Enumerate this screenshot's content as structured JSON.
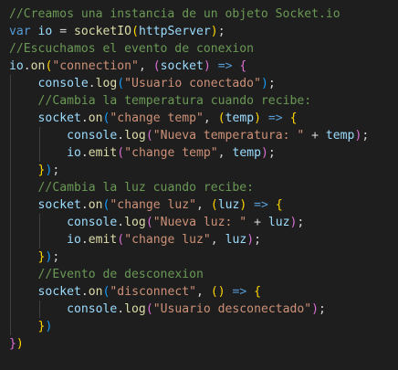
{
  "code_lines": [
    {
      "indent": 0,
      "tokens": [
        {
          "c": "cm",
          "t": "//Creamos una instancia de un objeto Socket.io"
        }
      ]
    },
    {
      "indent": 0,
      "tokens": [
        {
          "c": "kw",
          "t": "var"
        },
        {
          "c": "pn",
          "t": " "
        },
        {
          "c": "vr",
          "t": "io"
        },
        {
          "c": "pn",
          "t": " = "
        },
        {
          "c": "fn",
          "t": "socketIO"
        },
        {
          "c": "b1",
          "t": "("
        },
        {
          "c": "vr",
          "t": "httpServer"
        },
        {
          "c": "b1",
          "t": ")"
        },
        {
          "c": "pn",
          "t": ";"
        }
      ]
    },
    {
      "indent": 0,
      "tokens": [
        {
          "c": "cm",
          "t": "//Escuchamos el evento de conexion"
        }
      ]
    },
    {
      "indent": 0,
      "tokens": [
        {
          "c": "vr",
          "t": "io"
        },
        {
          "c": "pn",
          "t": "."
        },
        {
          "c": "fn",
          "t": "on"
        },
        {
          "c": "b1",
          "t": "("
        },
        {
          "c": "st",
          "t": "\"connection\""
        },
        {
          "c": "pn",
          "t": ", "
        },
        {
          "c": "b2",
          "t": "("
        },
        {
          "c": "vr",
          "t": "socket"
        },
        {
          "c": "b2",
          "t": ")"
        },
        {
          "c": "pn",
          "t": " "
        },
        {
          "c": "kw",
          "t": "=>"
        },
        {
          "c": "pn",
          "t": " "
        },
        {
          "c": "b2",
          "t": "{"
        }
      ]
    },
    {
      "indent": 1,
      "tokens": [
        {
          "c": "vr",
          "t": "console"
        },
        {
          "c": "pn",
          "t": "."
        },
        {
          "c": "fn",
          "t": "log"
        },
        {
          "c": "b3",
          "t": "("
        },
        {
          "c": "st",
          "t": "\"Usuario conectado\""
        },
        {
          "c": "b3",
          "t": ")"
        },
        {
          "c": "pn",
          "t": ";"
        }
      ]
    },
    {
      "indent": 1,
      "tokens": [
        {
          "c": "cm",
          "t": "//Cambia la temperatura cuando recibe:"
        }
      ]
    },
    {
      "indent": 1,
      "tokens": [
        {
          "c": "vr",
          "t": "socket"
        },
        {
          "c": "pn",
          "t": "."
        },
        {
          "c": "fn",
          "t": "on"
        },
        {
          "c": "b3",
          "t": "("
        },
        {
          "c": "st",
          "t": "\"change temp\""
        },
        {
          "c": "pn",
          "t": ", "
        },
        {
          "c": "b1",
          "t": "("
        },
        {
          "c": "vr",
          "t": "temp"
        },
        {
          "c": "b1",
          "t": ")"
        },
        {
          "c": "pn",
          "t": " "
        },
        {
          "c": "kw",
          "t": "=>"
        },
        {
          "c": "pn",
          "t": " "
        },
        {
          "c": "b1",
          "t": "{"
        }
      ]
    },
    {
      "indent": 2,
      "tokens": [
        {
          "c": "vr",
          "t": "console"
        },
        {
          "c": "pn",
          "t": "."
        },
        {
          "c": "fn",
          "t": "log"
        },
        {
          "c": "b2",
          "t": "("
        },
        {
          "c": "st",
          "t": "\"Nueva temperatura: \""
        },
        {
          "c": "pn",
          "t": " + "
        },
        {
          "c": "vr",
          "t": "temp"
        },
        {
          "c": "b2",
          "t": ")"
        },
        {
          "c": "pn",
          "t": ";"
        }
      ]
    },
    {
      "indent": 2,
      "tokens": [
        {
          "c": "vr",
          "t": "io"
        },
        {
          "c": "pn",
          "t": "."
        },
        {
          "c": "fn",
          "t": "emit"
        },
        {
          "c": "b2",
          "t": "("
        },
        {
          "c": "st",
          "t": "\"change temp\""
        },
        {
          "c": "pn",
          "t": ", "
        },
        {
          "c": "vr",
          "t": "temp"
        },
        {
          "c": "b2",
          "t": ")"
        },
        {
          "c": "pn",
          "t": ";"
        }
      ]
    },
    {
      "indent": 1,
      "tokens": [
        {
          "c": "b1",
          "t": "}"
        },
        {
          "c": "b3",
          "t": ")"
        },
        {
          "c": "pn",
          "t": ";"
        }
      ]
    },
    {
      "indent": 1,
      "tokens": [
        {
          "c": "cm",
          "t": "//Cambia la luz cuando recibe:"
        }
      ]
    },
    {
      "indent": 1,
      "tokens": [
        {
          "c": "vr",
          "t": "socket"
        },
        {
          "c": "pn",
          "t": "."
        },
        {
          "c": "fn",
          "t": "on"
        },
        {
          "c": "b3",
          "t": "("
        },
        {
          "c": "st",
          "t": "\"change luz\""
        },
        {
          "c": "pn",
          "t": ", "
        },
        {
          "c": "b1",
          "t": "("
        },
        {
          "c": "vr",
          "t": "luz"
        },
        {
          "c": "b1",
          "t": ")"
        },
        {
          "c": "pn",
          "t": " "
        },
        {
          "c": "kw",
          "t": "=>"
        },
        {
          "c": "pn",
          "t": " "
        },
        {
          "c": "b1",
          "t": "{"
        }
      ]
    },
    {
      "indent": 2,
      "tokens": [
        {
          "c": "vr",
          "t": "console"
        },
        {
          "c": "pn",
          "t": "."
        },
        {
          "c": "fn",
          "t": "log"
        },
        {
          "c": "b2",
          "t": "("
        },
        {
          "c": "st",
          "t": "\"Nueva luz: \""
        },
        {
          "c": "pn",
          "t": " + "
        },
        {
          "c": "vr",
          "t": "luz"
        },
        {
          "c": "b2",
          "t": ")"
        },
        {
          "c": "pn",
          "t": ";"
        }
      ]
    },
    {
      "indent": 2,
      "tokens": [
        {
          "c": "vr",
          "t": "io"
        },
        {
          "c": "pn",
          "t": "."
        },
        {
          "c": "fn",
          "t": "emit"
        },
        {
          "c": "b2",
          "t": "("
        },
        {
          "c": "st",
          "t": "\"change luz\""
        },
        {
          "c": "pn",
          "t": ", "
        },
        {
          "c": "vr",
          "t": "luz"
        },
        {
          "c": "b2",
          "t": ")"
        },
        {
          "c": "pn",
          "t": ";"
        }
      ]
    },
    {
      "indent": 1,
      "tokens": [
        {
          "c": "b1",
          "t": "}"
        },
        {
          "c": "b3",
          "t": ")"
        },
        {
          "c": "pn",
          "t": ";"
        }
      ]
    },
    {
      "indent": 1,
      "tokens": [
        {
          "c": "cm",
          "t": "//Evento de desconexion"
        }
      ]
    },
    {
      "indent": 1,
      "tokens": [
        {
          "c": "vr",
          "t": "socket"
        },
        {
          "c": "pn",
          "t": "."
        },
        {
          "c": "fn",
          "t": "on"
        },
        {
          "c": "b3",
          "t": "("
        },
        {
          "c": "st",
          "t": "\"disconnect\""
        },
        {
          "c": "pn",
          "t": ", "
        },
        {
          "c": "b1",
          "t": "()"
        },
        {
          "c": "pn",
          "t": " "
        },
        {
          "c": "kw",
          "t": "=>"
        },
        {
          "c": "pn",
          "t": " "
        },
        {
          "c": "b1",
          "t": "{"
        }
      ]
    },
    {
      "indent": 2,
      "tokens": [
        {
          "c": "vr",
          "t": "console"
        },
        {
          "c": "pn",
          "t": "."
        },
        {
          "c": "fn",
          "t": "log"
        },
        {
          "c": "b2",
          "t": "("
        },
        {
          "c": "st",
          "t": "\"Usuario desconectado\""
        },
        {
          "c": "b2",
          "t": ")"
        },
        {
          "c": "pn",
          "t": ";"
        }
      ]
    },
    {
      "indent": 1,
      "tokens": [
        {
          "c": "b1",
          "t": "}"
        },
        {
          "c": "b3",
          "t": ")"
        }
      ]
    },
    {
      "indent": 0,
      "tokens": [
        {
          "c": "b2",
          "t": "}"
        },
        {
          "c": "b1",
          "t": ")"
        }
      ]
    }
  ]
}
